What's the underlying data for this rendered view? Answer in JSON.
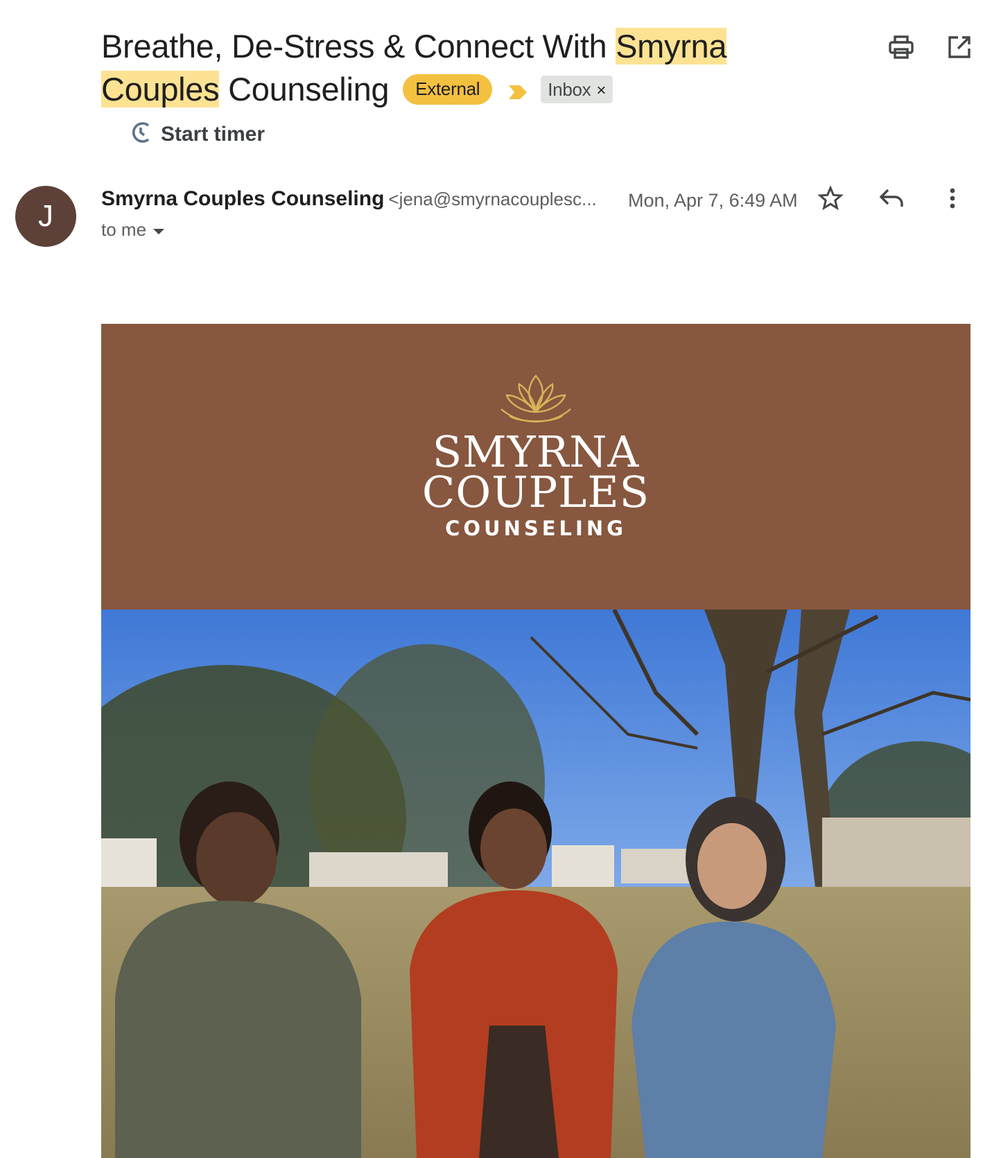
{
  "subject": {
    "part1": "Breathe, De-Stress & Connect With ",
    "highlight1": "Smyrna",
    "highlight2": "Couples",
    "part2": " Counseling"
  },
  "labels": {
    "external": "External",
    "inbox": "Inbox",
    "inbox_remove": "×"
  },
  "timer": {
    "label": "Start timer"
  },
  "sender": {
    "avatar_letter": "J",
    "name": "Smyrna Couples Counseling",
    "email": "<jena@smyrnacouplesc...",
    "date": "Mon, Apr 7, 6:49 AM",
    "to": "to me"
  },
  "logo": {
    "line1": "SMYRNA",
    "line2": "COUPLES",
    "line3": "COUNSELING"
  },
  "icons": {
    "print": "print-icon",
    "open_new_window": "open-in-new-icon",
    "timer": "timer-icon",
    "star": "star-icon",
    "reply": "reply-icon",
    "more": "more-vert-icon",
    "importance": "importance-marker-icon",
    "dropdown": "caret-down-icon"
  },
  "colors": {
    "highlight": "#fde293",
    "external_badge": "#f4c03f",
    "avatar": "#5d4037",
    "hero_bg": "#87573f",
    "logo_gold": "#d9b25a"
  }
}
